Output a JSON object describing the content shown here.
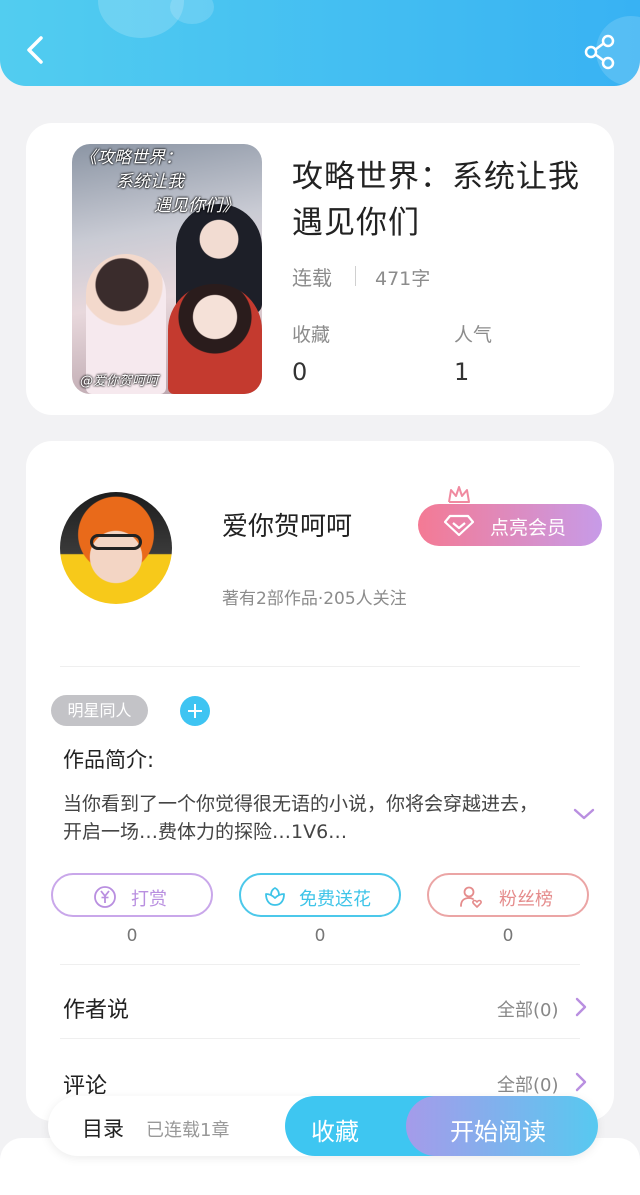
{
  "book": {
    "title": "攻略世界：系统让我遇见你们",
    "status": "连载",
    "word_count": "471字",
    "stats": [
      {
        "label": "收藏",
        "value": "0"
      },
      {
        "label": "人气",
        "value": "1"
      }
    ],
    "cover": {
      "lines": [
        "《攻略世界：",
        "系统让我",
        "遇见你们》"
      ],
      "signature": "@爱你贺呵呵"
    }
  },
  "author": {
    "name": "爱你贺呵呵",
    "vip_label": "点亮会员",
    "meta": "著有2部作品·205人关注"
  },
  "tags": [
    "明星同人"
  ],
  "intro": {
    "label": "作品简介:",
    "text": "当你看到了一个你觉得很无语的小说，你将会穿越进去，开启一场…费体力的探险…1V6…"
  },
  "actions": [
    {
      "label": "打赏",
      "count": "0",
      "icon": "yen-icon",
      "color": "#b98fe0"
    },
    {
      "label": "免费送花",
      "count": "0",
      "icon": "flower-icon",
      "color": "#3ec4e8"
    },
    {
      "label": "粉丝榜",
      "count": "0",
      "icon": "user-heart-icon",
      "color": "#e58c8c"
    }
  ],
  "sections": [
    {
      "label": "作者说",
      "right": "全部(0)"
    },
    {
      "label": "评论",
      "right": "全部(0)"
    }
  ],
  "bottom_bar": {
    "toc": "目录",
    "chapters": "已连载1章",
    "favorite": "收藏",
    "read": "开始阅读"
  },
  "colors": {
    "header": "#3fbff2",
    "accent": "#3ec6f1",
    "vip_gradient": [
      "#f47a94",
      "#c79be8"
    ],
    "chevron": "#b98fe0"
  }
}
